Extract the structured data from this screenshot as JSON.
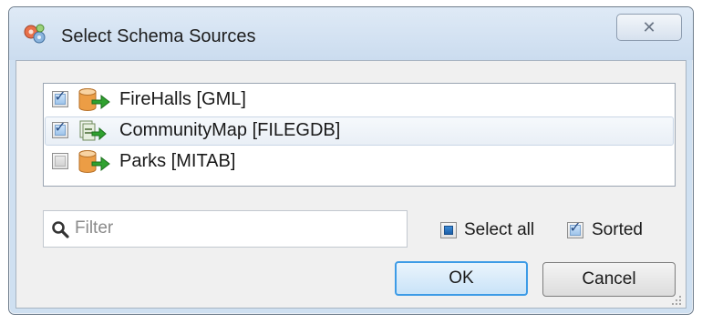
{
  "window": {
    "title": "Select Schema Sources",
    "close_icon": "close-icon"
  },
  "sources": [
    {
      "label": "FireHalls [GML]",
      "checked": true,
      "icon": "database-arrow-icon"
    },
    {
      "label": "CommunityMap [FILEGDB]",
      "checked": true,
      "icon": "filegdb-arrow-icon"
    },
    {
      "label": "Parks [MITAB]",
      "checked": false,
      "icon": "database-arrow-icon"
    }
  ],
  "filter": {
    "placeholder": "Filter",
    "value": ""
  },
  "options": {
    "select_all_label": "Select all",
    "select_all_state": "partial",
    "sorted_label": "Sorted",
    "sorted_checked": true
  },
  "buttons": {
    "ok_label": "OK",
    "cancel_label": "Cancel"
  },
  "colors": {
    "accent": "#3d9be6",
    "title_bar": "#cfe0f1",
    "arrow_green": "#2fa12f",
    "db_orange": "#e89a3c"
  }
}
